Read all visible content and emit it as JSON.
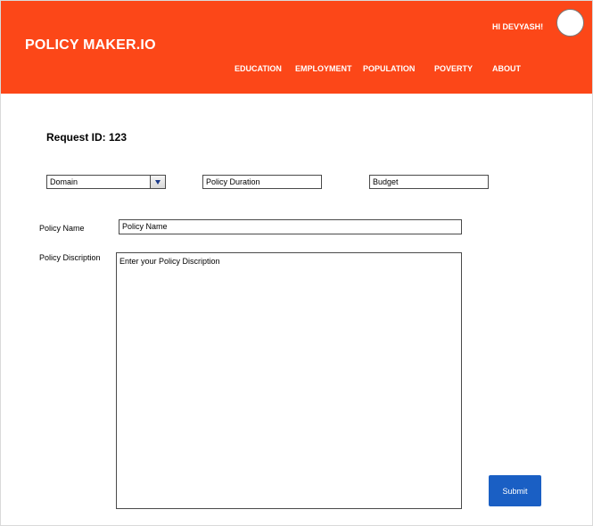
{
  "header": {
    "brand": "POLICY MAKER.IO",
    "greeting": "HI DEVYASH!",
    "nav": [
      "EDUCATION",
      "EMPLOYMENT",
      "POPULATION",
      "POVERTY",
      "ABOUT"
    ],
    "background_color": "#fc4718"
  },
  "form": {
    "request_id": "Request ID: 123",
    "domain_select": {
      "selected": "Domain"
    },
    "duration": {
      "value": "Policy Duration"
    },
    "budget": {
      "value": "Budget"
    },
    "policy_name": {
      "label": "Policy Name",
      "value": "Policy Name"
    },
    "policy_description": {
      "label": "Policy Discription",
      "value": "Enter your Policy Discription"
    },
    "submit_label": "Submit",
    "submit_color": "#1a5fc4"
  }
}
